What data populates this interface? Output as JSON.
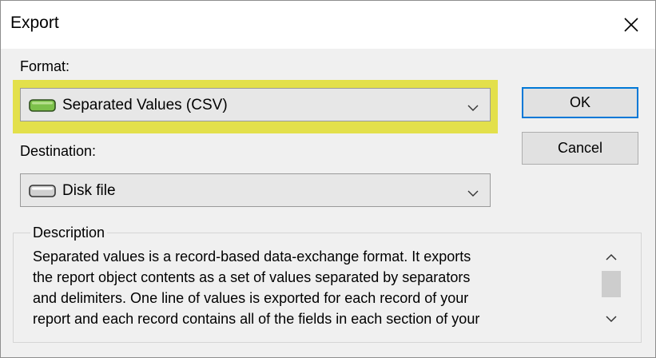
{
  "window": {
    "title": "Export"
  },
  "format": {
    "label": "Format:",
    "value": "Separated Values (CSV)",
    "icon": "drive-icon"
  },
  "destination": {
    "label": "Destination:",
    "value": "Disk file",
    "icon": "drive-icon"
  },
  "buttons": {
    "ok": "OK",
    "cancel": "Cancel"
  },
  "description": {
    "title": "Description",
    "lines": [
      "Separated values is a record-based data-exchange format.  It exports",
      "the report object contents as a set of values separated by separators",
      "and delimiters.  One line of values is exported for each record of your",
      "report and each record contains all of the fields in each section of your"
    ]
  },
  "colors": {
    "highlight": "#e3e04b",
    "default_button_border": "#0078d7"
  }
}
